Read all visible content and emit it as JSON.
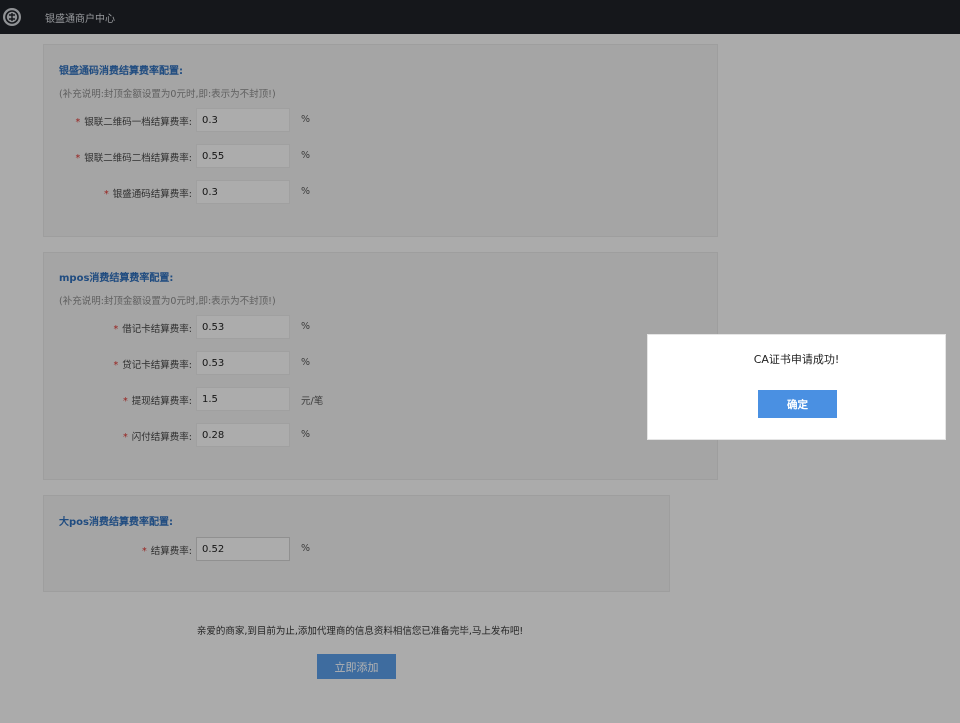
{
  "header": {
    "title": "银盛通商户中心",
    "logo_icon": "yinsheng-logo-icon"
  },
  "sections": [
    {
      "title": "银盛通码消费结算费率配置:",
      "note": "(补充说明:封顶金额设置为0元时,即:表示为不封顶!)",
      "rows": [
        {
          "required": "*",
          "label": "银联二维码一档结算费率:",
          "value": "0.3",
          "unit": "%"
        },
        {
          "required": "*",
          "label": "银联二维码二档结算费率:",
          "value": "0.55",
          "unit": "%"
        },
        {
          "required": "*",
          "label": "银盛通码结算费率:",
          "value": "0.3",
          "unit": "%"
        }
      ]
    },
    {
      "title": "mpos消费结算费率配置:",
      "note": "(补充说明:封顶金额设置为0元时,即:表示为不封顶!)",
      "rows": [
        {
          "required": "*",
          "label": "借记卡结算费率:",
          "value": "0.53",
          "unit": "%"
        },
        {
          "required": "*",
          "label": "贷记卡结算费率:",
          "value": "0.53",
          "unit": "%"
        },
        {
          "required": "*",
          "label": "提现结算费率:",
          "value": "1.5",
          "unit": "元/笔"
        },
        {
          "required": "*",
          "label": "闪付结算费率:",
          "value": "0.28",
          "unit": "%"
        }
      ]
    },
    {
      "title": "大pos消费结算费率配置:",
      "rows": [
        {
          "required": "*",
          "label": "结算费率:",
          "value": "0.52",
          "unit": "%"
        }
      ]
    }
  ],
  "footer": {
    "message": "亲爱的商家,到目前为止,添加代理商的信息资料相信您已准备完毕,马上发布吧!",
    "submit_label": "立即添加"
  },
  "dialog": {
    "message": "CA证书申请成功!",
    "confirm_label": "确定"
  },
  "colors": {
    "topbar": "#1f2228",
    "section_title": "#2e6db8",
    "required": "#d9302b",
    "primary_button": "#4a90e2"
  }
}
